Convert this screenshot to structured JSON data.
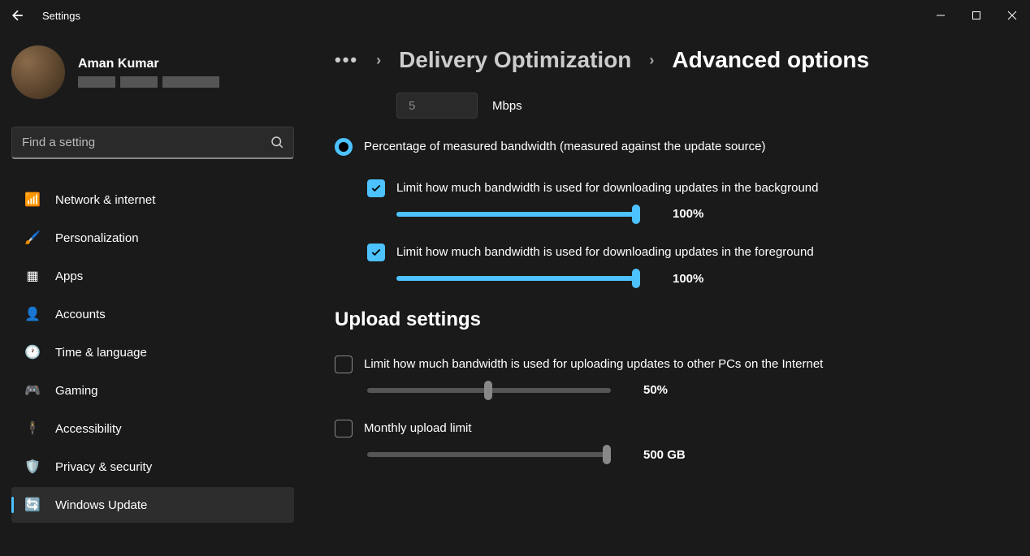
{
  "window": {
    "title": "Settings"
  },
  "profile": {
    "name": "Aman Kumar"
  },
  "search": {
    "placeholder": "Find a setting"
  },
  "sidebar": {
    "items": [
      {
        "label": "Network & internet",
        "icon": "wifi"
      },
      {
        "label": "Personalization",
        "icon": "brush"
      },
      {
        "label": "Apps",
        "icon": "apps"
      },
      {
        "label": "Accounts",
        "icon": "account"
      },
      {
        "label": "Time & language",
        "icon": "clock"
      },
      {
        "label": "Gaming",
        "icon": "game"
      },
      {
        "label": "Accessibility",
        "icon": "accessibility"
      },
      {
        "label": "Privacy & security",
        "icon": "shield"
      },
      {
        "label": "Windows Update",
        "icon": "update"
      }
    ]
  },
  "breadcrumb": {
    "parent": "Delivery Optimization",
    "current": "Advanced options"
  },
  "mbps": {
    "value": "5",
    "unit": "Mbps"
  },
  "radio_label": "Percentage of measured bandwidth (measured against the update source)",
  "bg": {
    "label": "Limit how much bandwidth is used for downloading updates in the background",
    "value": "100%"
  },
  "fg": {
    "label": "Limit how much bandwidth is used for downloading updates in the foreground",
    "value": "100%"
  },
  "upload_heading": "Upload settings",
  "upload_limit": {
    "label": "Limit how much bandwidth is used for uploading updates to other PCs on the Internet",
    "value": "50%"
  },
  "monthly": {
    "label": "Monthly upload limit",
    "value": "500 GB"
  }
}
